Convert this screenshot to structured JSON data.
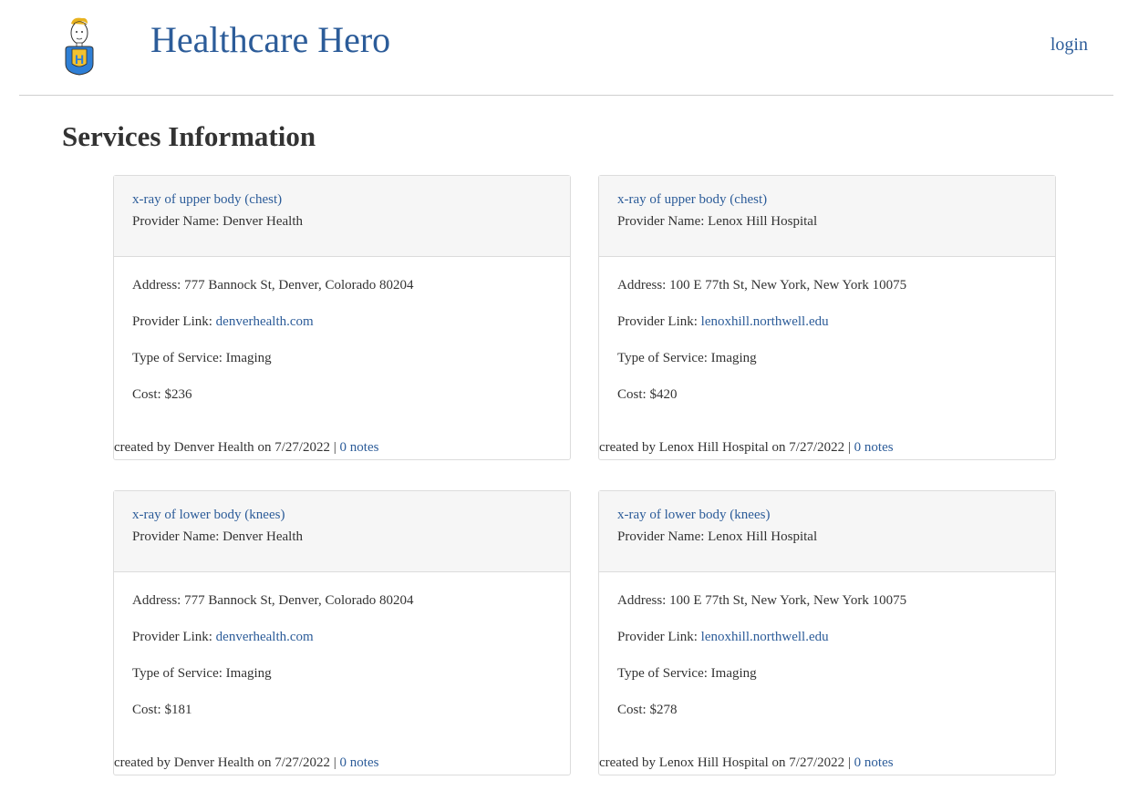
{
  "header": {
    "site_title": "Healthcare Hero",
    "login_label": "login"
  },
  "page": {
    "title": "Services Information"
  },
  "labels": {
    "provider_name": "Provider Name: ",
    "address": "Address: ",
    "provider_link": "Provider Link: ",
    "type_of_service": "Type of Service: ",
    "cost": "Cost: ",
    "created_by": "created by ",
    "on": " on ",
    "separator": " | "
  },
  "cards": [
    {
      "service": "x-ray of upper body (chest)",
      "provider_name": "Denver Health",
      "address": "777 Bannock St, Denver, Colorado 80204",
      "provider_link": "denverhealth.com",
      "type_of_service": "Imaging",
      "cost": "$236",
      "created_by": "Denver Health",
      "date": "7/27/2022",
      "notes": "0 notes"
    },
    {
      "service": "x-ray of upper body (chest)",
      "provider_name": "Lenox Hill Hospital",
      "address": "100 E 77th St, New York, New York 10075",
      "provider_link": "lenoxhill.northwell.edu",
      "type_of_service": "Imaging",
      "cost": "$420",
      "created_by": "Lenox Hill Hospital",
      "date": "7/27/2022",
      "notes": "0 notes"
    },
    {
      "service": "x-ray of lower body (knees)",
      "provider_name": "Denver Health",
      "address": "777 Bannock St, Denver, Colorado 80204",
      "provider_link": "denverhealth.com",
      "type_of_service": "Imaging",
      "cost": "$181",
      "created_by": "Denver Health",
      "date": "7/27/2022",
      "notes": "0 notes"
    },
    {
      "service": "x-ray of lower body (knees)",
      "provider_name": "Lenox Hill Hospital",
      "address": "100 E 77th St, New York, New York 10075",
      "provider_link": "lenoxhill.northwell.edu",
      "type_of_service": "Imaging",
      "cost": "$278",
      "created_by": "Lenox Hill Hospital",
      "date": "7/27/2022",
      "notes": "0 notes"
    }
  ],
  "colors": {
    "brand": "#2c5c99",
    "text": "#333333",
    "card_header_bg": "#f6f6f6",
    "border": "#dcdcdc"
  },
  "icons": {
    "logo": "superhero-logo-icon"
  }
}
